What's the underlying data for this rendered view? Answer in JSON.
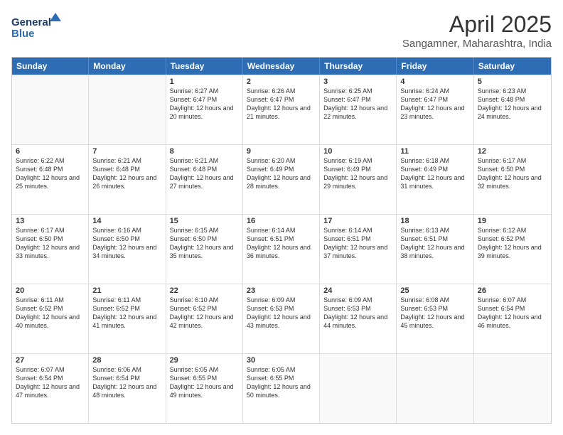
{
  "logo": {
    "line1": "General",
    "line2": "Blue"
  },
  "title": "April 2025",
  "subtitle": "Sangamner, Maharashtra, India",
  "header_days": [
    "Sunday",
    "Monday",
    "Tuesday",
    "Wednesday",
    "Thursday",
    "Friday",
    "Saturday"
  ],
  "rows": [
    [
      {
        "day": "",
        "text": ""
      },
      {
        "day": "",
        "text": ""
      },
      {
        "day": "1",
        "text": "Sunrise: 6:27 AM\nSunset: 6:47 PM\nDaylight: 12 hours and 20 minutes."
      },
      {
        "day": "2",
        "text": "Sunrise: 6:26 AM\nSunset: 6:47 PM\nDaylight: 12 hours and 21 minutes."
      },
      {
        "day": "3",
        "text": "Sunrise: 6:25 AM\nSunset: 6:47 PM\nDaylight: 12 hours and 22 minutes."
      },
      {
        "day": "4",
        "text": "Sunrise: 6:24 AM\nSunset: 6:47 PM\nDaylight: 12 hours and 23 minutes."
      },
      {
        "day": "5",
        "text": "Sunrise: 6:23 AM\nSunset: 6:48 PM\nDaylight: 12 hours and 24 minutes."
      }
    ],
    [
      {
        "day": "6",
        "text": "Sunrise: 6:22 AM\nSunset: 6:48 PM\nDaylight: 12 hours and 25 minutes."
      },
      {
        "day": "7",
        "text": "Sunrise: 6:21 AM\nSunset: 6:48 PM\nDaylight: 12 hours and 26 minutes."
      },
      {
        "day": "8",
        "text": "Sunrise: 6:21 AM\nSunset: 6:48 PM\nDaylight: 12 hours and 27 minutes."
      },
      {
        "day": "9",
        "text": "Sunrise: 6:20 AM\nSunset: 6:49 PM\nDaylight: 12 hours and 28 minutes."
      },
      {
        "day": "10",
        "text": "Sunrise: 6:19 AM\nSunset: 6:49 PM\nDaylight: 12 hours and 29 minutes."
      },
      {
        "day": "11",
        "text": "Sunrise: 6:18 AM\nSunset: 6:49 PM\nDaylight: 12 hours and 31 minutes."
      },
      {
        "day": "12",
        "text": "Sunrise: 6:17 AM\nSunset: 6:50 PM\nDaylight: 12 hours and 32 minutes."
      }
    ],
    [
      {
        "day": "13",
        "text": "Sunrise: 6:17 AM\nSunset: 6:50 PM\nDaylight: 12 hours and 33 minutes."
      },
      {
        "day": "14",
        "text": "Sunrise: 6:16 AM\nSunset: 6:50 PM\nDaylight: 12 hours and 34 minutes."
      },
      {
        "day": "15",
        "text": "Sunrise: 6:15 AM\nSunset: 6:50 PM\nDaylight: 12 hours and 35 minutes."
      },
      {
        "day": "16",
        "text": "Sunrise: 6:14 AM\nSunset: 6:51 PM\nDaylight: 12 hours and 36 minutes."
      },
      {
        "day": "17",
        "text": "Sunrise: 6:14 AM\nSunset: 6:51 PM\nDaylight: 12 hours and 37 minutes."
      },
      {
        "day": "18",
        "text": "Sunrise: 6:13 AM\nSunset: 6:51 PM\nDaylight: 12 hours and 38 minutes."
      },
      {
        "day": "19",
        "text": "Sunrise: 6:12 AM\nSunset: 6:52 PM\nDaylight: 12 hours and 39 minutes."
      }
    ],
    [
      {
        "day": "20",
        "text": "Sunrise: 6:11 AM\nSunset: 6:52 PM\nDaylight: 12 hours and 40 minutes."
      },
      {
        "day": "21",
        "text": "Sunrise: 6:11 AM\nSunset: 6:52 PM\nDaylight: 12 hours and 41 minutes."
      },
      {
        "day": "22",
        "text": "Sunrise: 6:10 AM\nSunset: 6:52 PM\nDaylight: 12 hours and 42 minutes."
      },
      {
        "day": "23",
        "text": "Sunrise: 6:09 AM\nSunset: 6:53 PM\nDaylight: 12 hours and 43 minutes."
      },
      {
        "day": "24",
        "text": "Sunrise: 6:09 AM\nSunset: 6:53 PM\nDaylight: 12 hours and 44 minutes."
      },
      {
        "day": "25",
        "text": "Sunrise: 6:08 AM\nSunset: 6:53 PM\nDaylight: 12 hours and 45 minutes."
      },
      {
        "day": "26",
        "text": "Sunrise: 6:07 AM\nSunset: 6:54 PM\nDaylight: 12 hours and 46 minutes."
      }
    ],
    [
      {
        "day": "27",
        "text": "Sunrise: 6:07 AM\nSunset: 6:54 PM\nDaylight: 12 hours and 47 minutes."
      },
      {
        "day": "28",
        "text": "Sunrise: 6:06 AM\nSunset: 6:54 PM\nDaylight: 12 hours and 48 minutes."
      },
      {
        "day": "29",
        "text": "Sunrise: 6:05 AM\nSunset: 6:55 PM\nDaylight: 12 hours and 49 minutes."
      },
      {
        "day": "30",
        "text": "Sunrise: 6:05 AM\nSunset: 6:55 PM\nDaylight: 12 hours and 50 minutes."
      },
      {
        "day": "",
        "text": ""
      },
      {
        "day": "",
        "text": ""
      },
      {
        "day": "",
        "text": ""
      }
    ]
  ]
}
